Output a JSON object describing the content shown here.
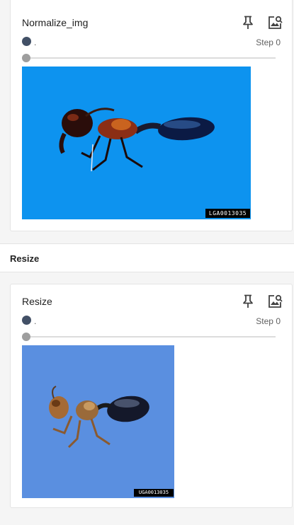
{
  "cards": [
    {
      "title": "Normalize_img",
      "run_label": ".",
      "step_label": "Step 0",
      "run_color": "#425066",
      "pin_icon": "pin-icon",
      "expand_icon": "expand-image-icon",
      "image_stamp": "LGA0013035",
      "image_background": "#0d93ef"
    },
    {
      "title": "Resize",
      "run_label": ".",
      "step_label": "Step 0",
      "run_color": "#425066",
      "pin_icon": "pin-icon",
      "expand_icon": "expand-image-icon",
      "image_stamp": "UGA0013035",
      "image_background": "#5a8fe0"
    }
  ],
  "section": {
    "title": "Resize"
  }
}
